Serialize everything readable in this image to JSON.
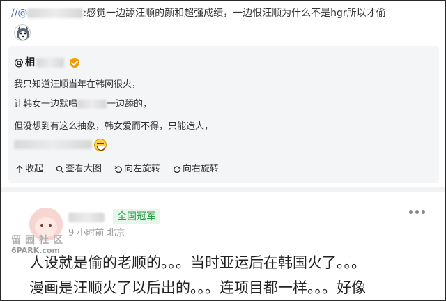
{
  "repost": {
    "prefix": "//@",
    "text": ":感觉一边舔汪顺的颜和超强成绩，一边恨汪顺为什么不是hgr所以才偷"
  },
  "quoted": {
    "user_prefix": "@",
    "lines": [
      "我只知道汪顺当年在韩网很火，",
      "让韩女一边默唱",
      "一边舔的，",
      "但没想到有这么抽象，韩女爱而不得，只能造人，"
    ]
  },
  "toolbar": {
    "collapse": "收起",
    "view_large": "查看大图",
    "rotate_left": "向左旋转",
    "rotate_right": "向右旋转"
  },
  "comment": {
    "badge": "全国冠军",
    "meta": "9 小时前 北京",
    "line1": "人设就是偷的老顺的。。。当时亚运后在韩国火了。。。",
    "line2": "漫画是汪顺火了以后出的。。。连项目都一样。。。好像"
  },
  "watermark": {
    "top": "留园社区",
    "bottom": "6PARK.com"
  }
}
